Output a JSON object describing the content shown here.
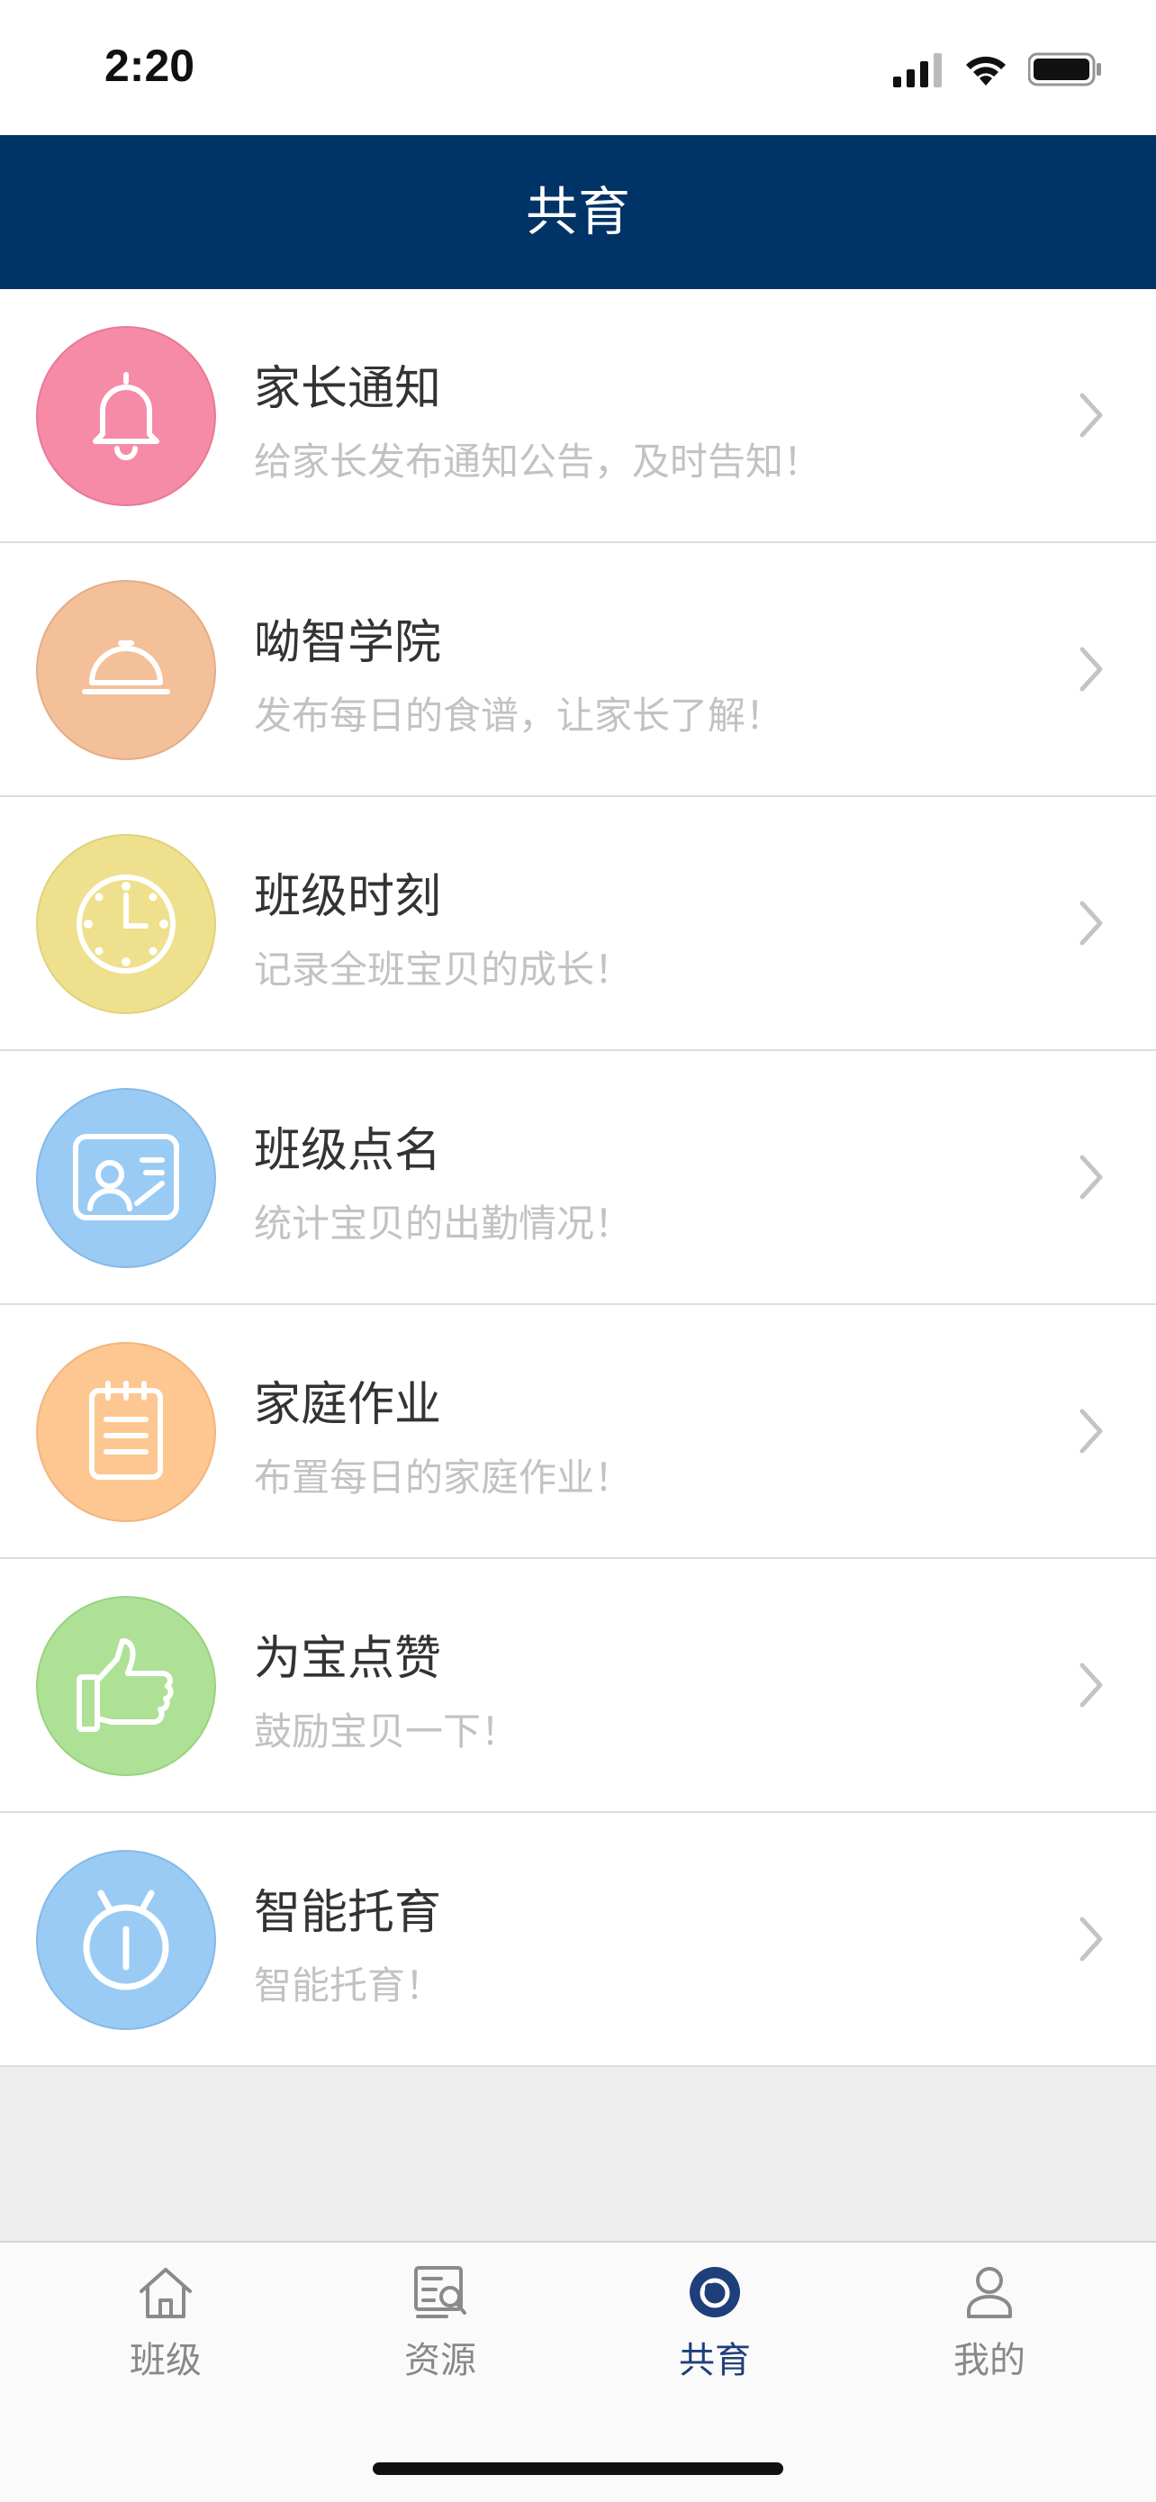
{
  "status_bar": {
    "time": "2:20"
  },
  "header": {
    "title": "共育"
  },
  "features": [
    {
      "title": "家长通知",
      "subtitle": "给家长发布通知公告，及时告知！",
      "icon": "bell-icon",
      "color": "#f68ba7",
      "border": "#e77a96"
    },
    {
      "title": "呦智学院",
      "subtitle": "发布每日的食谱，让家长了解！",
      "icon": "cloche-icon",
      "color": "#f3c09a",
      "border": "#e3ad86"
    },
    {
      "title": "班级时刻",
      "subtitle": "记录全班宝贝的成长！",
      "icon": "clock-icon",
      "color": "#eee08c",
      "border": "#e0d27c"
    },
    {
      "title": "班级点名",
      "subtitle": "统计宝贝的出勤情况！",
      "icon": "id-card-icon",
      "color": "#9acbf5",
      "border": "#86b9e6"
    },
    {
      "title": "家庭作业",
      "subtitle": "布置每日的家庭作业！",
      "icon": "notepad-icon",
      "color": "#fec690",
      "border": "#f1b67d"
    },
    {
      "title": "为宝点赞",
      "subtitle": "鼓励宝贝一下！",
      "icon": "thumbs-up-icon",
      "color": "#aee196",
      "border": "#98d27f"
    },
    {
      "title": "智能托育",
      "subtitle": "智能托育！",
      "icon": "smart-device-icon",
      "color": "#9acbf5",
      "border": "#86b9e6"
    }
  ],
  "tabs": [
    {
      "label": "班级",
      "icon": "home-icon",
      "active": false
    },
    {
      "label": "资源",
      "icon": "resources-icon",
      "active": false
    },
    {
      "label": "共育",
      "icon": "coeducation-icon",
      "active": true
    },
    {
      "label": "我的",
      "icon": "profile-icon",
      "active": false
    }
  ],
  "colors": {
    "nav": "#003366",
    "active_tab": "#1f3f7a"
  }
}
